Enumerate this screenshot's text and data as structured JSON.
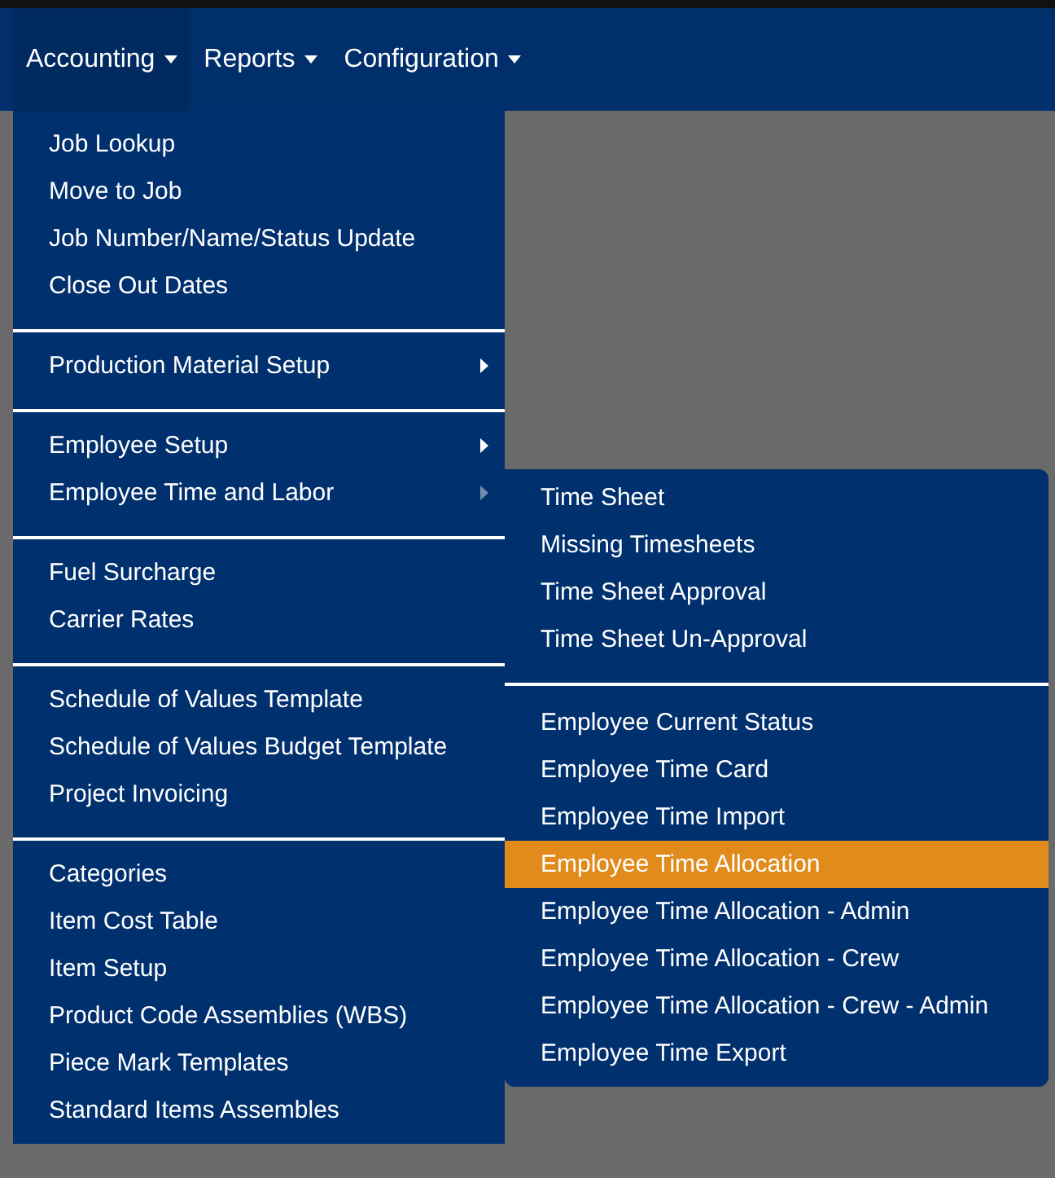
{
  "navbar": {
    "menus": [
      {
        "label": "Accounting",
        "selected": true
      },
      {
        "label": "Reports",
        "selected": false
      },
      {
        "label": "Configuration",
        "selected": false
      }
    ]
  },
  "dropdown": {
    "groups": [
      {
        "items": [
          {
            "label": "Job Lookup",
            "has_submenu": false
          },
          {
            "label": "Move to Job",
            "has_submenu": false
          },
          {
            "label": "Job Number/Name/Status Update",
            "has_submenu": false
          },
          {
            "label": "Close Out Dates",
            "has_submenu": false
          }
        ]
      },
      {
        "items": [
          {
            "label": "Production Material Setup",
            "has_submenu": true,
            "expanded": false
          }
        ]
      },
      {
        "items": [
          {
            "label": "Employee Setup",
            "has_submenu": true,
            "expanded": false
          },
          {
            "label": "Employee Time and Labor",
            "has_submenu": true,
            "expanded": true
          }
        ]
      },
      {
        "items": [
          {
            "label": "Fuel Surcharge",
            "has_submenu": false
          },
          {
            "label": "Carrier Rates",
            "has_submenu": false
          }
        ]
      },
      {
        "items": [
          {
            "label": "Schedule of Values Template",
            "has_submenu": false
          },
          {
            "label": "Schedule of Values Budget Template",
            "has_submenu": false
          },
          {
            "label": "Project Invoicing",
            "has_submenu": false
          }
        ]
      },
      {
        "items": [
          {
            "label": "Categories",
            "has_submenu": false
          },
          {
            "label": "Item Cost Table",
            "has_submenu": false
          },
          {
            "label": "Item Setup",
            "has_submenu": false
          },
          {
            "label": "Product Code Assemblies (WBS)",
            "has_submenu": false
          },
          {
            "label": "Piece Mark Templates",
            "has_submenu": false
          },
          {
            "label": "Standard Items Assembles",
            "has_submenu": false
          }
        ]
      }
    ]
  },
  "submenu": {
    "groups": [
      {
        "items": [
          {
            "label": "Time Sheet",
            "selected": false
          },
          {
            "label": "Missing Timesheets",
            "selected": false
          },
          {
            "label": "Time Sheet Approval",
            "selected": false
          },
          {
            "label": "Time Sheet Un-Approval",
            "selected": false
          }
        ]
      },
      {
        "items": [
          {
            "label": "Employee Current Status",
            "selected": false
          },
          {
            "label": "Employee Time Card",
            "selected": false
          },
          {
            "label": "Employee Time Import",
            "selected": false
          },
          {
            "label": "Employee Time Allocation",
            "selected": true
          },
          {
            "label": "Employee Time Allocation - Admin",
            "selected": false
          },
          {
            "label": "Employee Time Allocation - Crew",
            "selected": false
          },
          {
            "label": "Employee Time Allocation - Crew - Admin",
            "selected": false
          },
          {
            "label": "Employee Time Export",
            "selected": false
          }
        ]
      }
    ]
  }
}
